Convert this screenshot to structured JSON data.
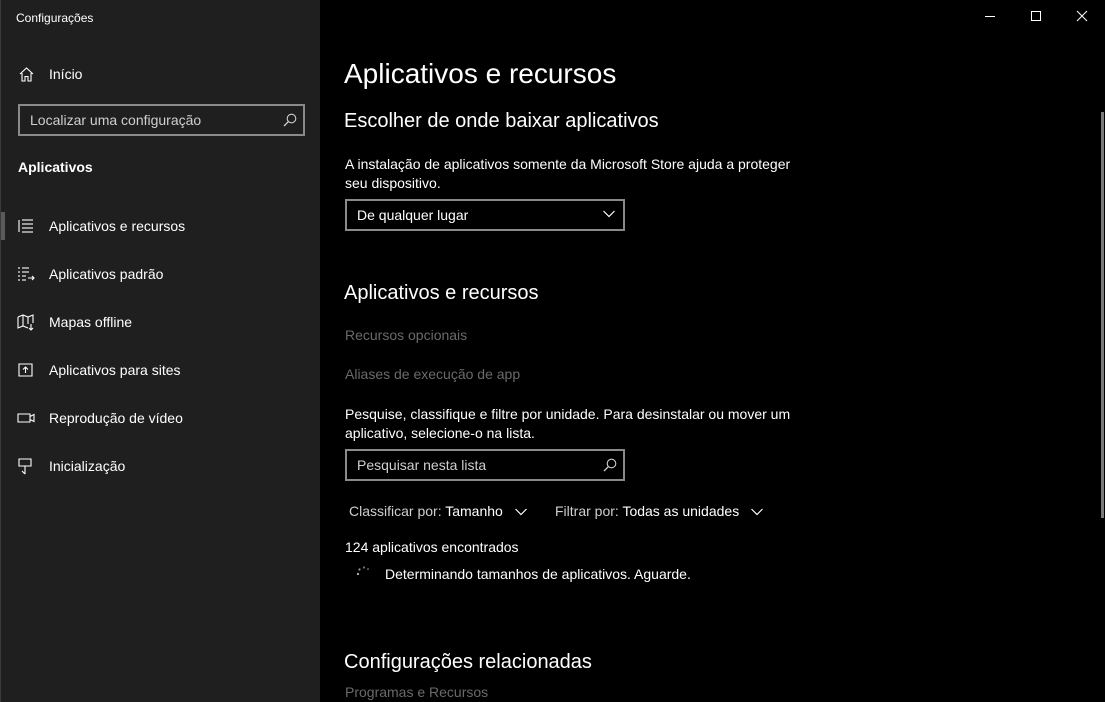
{
  "window": {
    "title": "Configurações"
  },
  "sidebar": {
    "home_label": "Início",
    "search_placeholder": "Localizar uma configuração",
    "section_title": "Aplicativos",
    "items": [
      {
        "label": "Aplicativos e recursos",
        "icon": "list-icon",
        "active": true
      },
      {
        "label": "Aplicativos padrão",
        "icon": "default-apps-icon",
        "active": false
      },
      {
        "label": "Mapas offline",
        "icon": "map-icon",
        "active": false
      },
      {
        "label": "Aplicativos para sites",
        "icon": "open-in-app-icon",
        "active": false
      },
      {
        "label": "Reprodução de vídeo",
        "icon": "video-icon",
        "active": false
      },
      {
        "label": "Inicialização",
        "icon": "startup-icon",
        "active": false
      }
    ]
  },
  "main": {
    "page_title": "Aplicativos e recursos",
    "install_section": {
      "heading": "Escolher de onde baixar aplicativos",
      "description_line1": "A instalação de aplicativos somente da Microsoft Store ajuda a proteger",
      "description_line2": "seu dispositivo.",
      "dropdown_value": "De qualquer lugar"
    },
    "apps_section": {
      "heading": "Aplicativos e recursos",
      "optional_features_link": "Recursos opcionais",
      "aliases_link": "Aliases de execução de app",
      "description_line1": "Pesquise, classifique e filtre por unidade. Para desinstalar ou mover um",
      "description_line2": "aplicativo, selecione-o na lista.",
      "search_placeholder": "Pesquisar nesta lista",
      "sort_label": "Classificar por:",
      "sort_value": "Tamanho",
      "filter_label": "Filtrar por:",
      "filter_value": "Todas as unidades",
      "count_text": "124 aplicativos encontrados",
      "status_text": "Determinando tamanhos de aplicativos. Aguarde."
    },
    "related_section": {
      "heading": "Configurações relacionadas",
      "link": "Programas e Recursos"
    }
  },
  "colors": {
    "sidebar_bg": "#1f1f1f",
    "main_bg": "#000000",
    "disabled_text": "#6a6a6a"
  }
}
